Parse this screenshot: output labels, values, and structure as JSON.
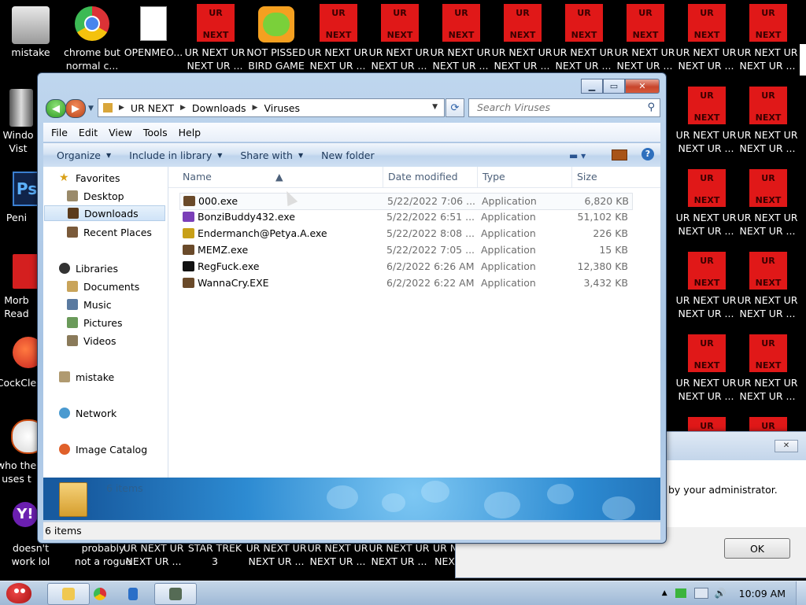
{
  "desktop": {
    "icons_left": [
      {
        "label_1": "mistake",
        "label_2": ""
      },
      {
        "label_1": "Windo",
        "label_2": "Vist"
      },
      {
        "label_1": "Peni",
        "label_2": ""
      },
      {
        "label_1": "Morb",
        "label_2": "Read"
      },
      {
        "label_1": "CockCle",
        "label_2": ""
      },
      {
        "label_1": "who the",
        "label_2": "uses t"
      },
      {
        "label_1": "doesn't",
        "label_2": "work lol"
      }
    ],
    "top_icons": [
      {
        "label_1": "chrome but",
        "label_2": "normal c..."
      },
      {
        "label_1": "OPENMEO...",
        "label_2": ""
      },
      {
        "label_1": "UR NEXT UR",
        "label_2": "NEXT UR ..."
      },
      {
        "label_1": "NOT PISSED",
        "label_2": "BIRD GAME"
      }
    ],
    "urnext_text_top": "UR",
    "urnext_text_bottom": "NEXT",
    "urnext_label_1": "UR NEXT UR",
    "urnext_label_2": "NEXT UR ...",
    "bottom_icons": [
      {
        "label_1": "probably",
        "label_2": "not a rogue"
      },
      {
        "label_1": "UR NEXT UR",
        "label_2": "NEXT UR ..."
      },
      {
        "label_1": "STAR TREK",
        "label_2": "3"
      },
      {
        "label_1": "UR NEXT UR",
        "label_2": "NEXT UR ..."
      },
      {
        "label_1": "UR NEXT UR",
        "label_2": "NEXT UR ..."
      },
      {
        "label_1": "UR NEXT UR",
        "label_2": "NEXT UR ..."
      },
      {
        "label_1": "UR N",
        "label_2": "NEX"
      }
    ]
  },
  "explorer": {
    "address": [
      "UR NEXT",
      "Downloads",
      "Viruses"
    ],
    "search_placeholder": "Search Viruses",
    "menu": [
      "File",
      "Edit",
      "View",
      "Tools",
      "Help"
    ],
    "commands": {
      "organize": "Organize",
      "include": "Include in library",
      "share": "Share with",
      "new_folder": "New folder"
    },
    "nav": {
      "favorites": "Favorites",
      "desktop": "Desktop",
      "downloads": "Downloads",
      "recent": "Recent Places",
      "libraries": "Libraries",
      "documents": "Documents",
      "music": "Music",
      "pictures": "Pictures",
      "videos": "Videos",
      "user": "mistake",
      "network": "Network",
      "image_catalog": "Image Catalog"
    },
    "columns": {
      "name": "Name",
      "date": "Date modified",
      "type": "Type",
      "size": "Size"
    },
    "files": [
      {
        "name": "000.exe",
        "date": "5/22/2022 7:06 ...",
        "type": "Application",
        "size": "6,820 KB",
        "icon_color": "#6a4a2a"
      },
      {
        "name": "BonziBuddy432.exe",
        "date": "5/22/2022 6:51 ...",
        "type": "Application",
        "size": "51,102 KB",
        "icon_color": "#7b3fb8"
      },
      {
        "name": "Endermanch@Petya.A.exe",
        "date": "5/22/2022 8:08 ...",
        "type": "Application",
        "size": "226 KB",
        "icon_color": "#c8a018"
      },
      {
        "name": "MEMZ.exe",
        "date": "5/22/2022 7:05 ...",
        "type": "Application",
        "size": "15 KB",
        "icon_color": "#6a4a2a"
      },
      {
        "name": "RegFuck.exe",
        "date": "6/2/2022 6:26 AM",
        "type": "Application",
        "size": "12,380 KB",
        "icon_color": "#111111"
      },
      {
        "name": "WannaCry.EXE",
        "date": "6/2/2022 6:22 AM",
        "type": "Application",
        "size": "3,432 KB",
        "icon_color": "#6a4a2a"
      }
    ],
    "details_count": "6 items",
    "status": "6 items"
  },
  "dialog": {
    "message": "by your administrator.",
    "ok": "OK"
  },
  "taskbar": {
    "clock": "10:09 AM"
  }
}
